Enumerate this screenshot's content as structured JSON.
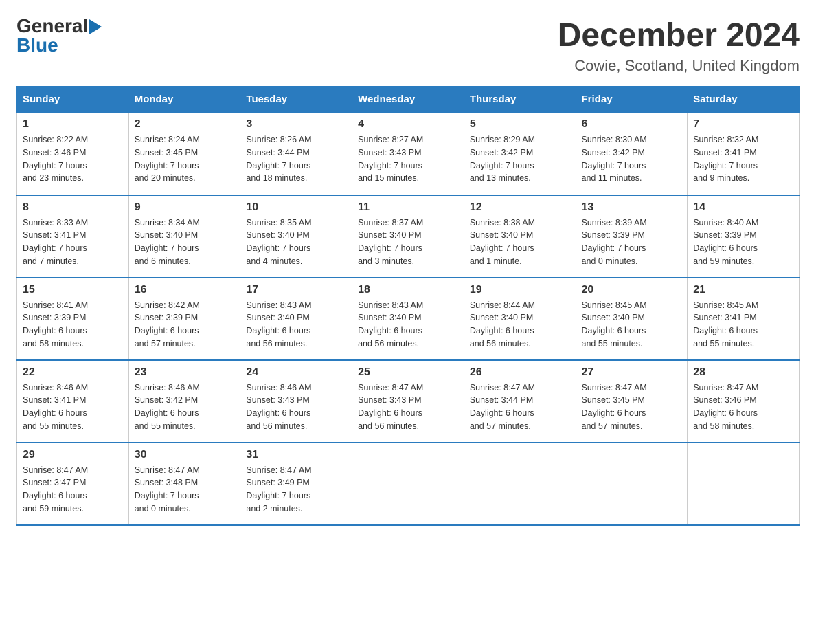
{
  "logo": {
    "general": "General",
    "flag_shape": "▶",
    "blue": "Blue"
  },
  "title": "December 2024",
  "location": "Cowie, Scotland, United Kingdom",
  "days_of_week": [
    "Sunday",
    "Monday",
    "Tuesday",
    "Wednesday",
    "Thursday",
    "Friday",
    "Saturday"
  ],
  "weeks": [
    [
      {
        "day": "1",
        "sunrise": "8:22 AM",
        "sunset": "3:46 PM",
        "daylight": "7 hours and 23 minutes."
      },
      {
        "day": "2",
        "sunrise": "8:24 AM",
        "sunset": "3:45 PM",
        "daylight": "7 hours and 20 minutes."
      },
      {
        "day": "3",
        "sunrise": "8:26 AM",
        "sunset": "3:44 PM",
        "daylight": "7 hours and 18 minutes."
      },
      {
        "day": "4",
        "sunrise": "8:27 AM",
        "sunset": "3:43 PM",
        "daylight": "7 hours and 15 minutes."
      },
      {
        "day": "5",
        "sunrise": "8:29 AM",
        "sunset": "3:42 PM",
        "daylight": "7 hours and 13 minutes."
      },
      {
        "day": "6",
        "sunrise": "8:30 AM",
        "sunset": "3:42 PM",
        "daylight": "7 hours and 11 minutes."
      },
      {
        "day": "7",
        "sunrise": "8:32 AM",
        "sunset": "3:41 PM",
        "daylight": "7 hours and 9 minutes."
      }
    ],
    [
      {
        "day": "8",
        "sunrise": "8:33 AM",
        "sunset": "3:41 PM",
        "daylight": "7 hours and 7 minutes."
      },
      {
        "day": "9",
        "sunrise": "8:34 AM",
        "sunset": "3:40 PM",
        "daylight": "7 hours and 6 minutes."
      },
      {
        "day": "10",
        "sunrise": "8:35 AM",
        "sunset": "3:40 PM",
        "daylight": "7 hours and 4 minutes."
      },
      {
        "day": "11",
        "sunrise": "8:37 AM",
        "sunset": "3:40 PM",
        "daylight": "7 hours and 3 minutes."
      },
      {
        "day": "12",
        "sunrise": "8:38 AM",
        "sunset": "3:40 PM",
        "daylight": "7 hours and 1 minute."
      },
      {
        "day": "13",
        "sunrise": "8:39 AM",
        "sunset": "3:39 PM",
        "daylight": "7 hours and 0 minutes."
      },
      {
        "day": "14",
        "sunrise": "8:40 AM",
        "sunset": "3:39 PM",
        "daylight": "6 hours and 59 minutes."
      }
    ],
    [
      {
        "day": "15",
        "sunrise": "8:41 AM",
        "sunset": "3:39 PM",
        "daylight": "6 hours and 58 minutes."
      },
      {
        "day": "16",
        "sunrise": "8:42 AM",
        "sunset": "3:39 PM",
        "daylight": "6 hours and 57 minutes."
      },
      {
        "day": "17",
        "sunrise": "8:43 AM",
        "sunset": "3:40 PM",
        "daylight": "6 hours and 56 minutes."
      },
      {
        "day": "18",
        "sunrise": "8:43 AM",
        "sunset": "3:40 PM",
        "daylight": "6 hours and 56 minutes."
      },
      {
        "day": "19",
        "sunrise": "8:44 AM",
        "sunset": "3:40 PM",
        "daylight": "6 hours and 56 minutes."
      },
      {
        "day": "20",
        "sunrise": "8:45 AM",
        "sunset": "3:40 PM",
        "daylight": "6 hours and 55 minutes."
      },
      {
        "day": "21",
        "sunrise": "8:45 AM",
        "sunset": "3:41 PM",
        "daylight": "6 hours and 55 minutes."
      }
    ],
    [
      {
        "day": "22",
        "sunrise": "8:46 AM",
        "sunset": "3:41 PM",
        "daylight": "6 hours and 55 minutes."
      },
      {
        "day": "23",
        "sunrise": "8:46 AM",
        "sunset": "3:42 PM",
        "daylight": "6 hours and 55 minutes."
      },
      {
        "day": "24",
        "sunrise": "8:46 AM",
        "sunset": "3:43 PM",
        "daylight": "6 hours and 56 minutes."
      },
      {
        "day": "25",
        "sunrise": "8:47 AM",
        "sunset": "3:43 PM",
        "daylight": "6 hours and 56 minutes."
      },
      {
        "day": "26",
        "sunrise": "8:47 AM",
        "sunset": "3:44 PM",
        "daylight": "6 hours and 57 minutes."
      },
      {
        "day": "27",
        "sunrise": "8:47 AM",
        "sunset": "3:45 PM",
        "daylight": "6 hours and 57 minutes."
      },
      {
        "day": "28",
        "sunrise": "8:47 AM",
        "sunset": "3:46 PM",
        "daylight": "6 hours and 58 minutes."
      }
    ],
    [
      {
        "day": "29",
        "sunrise": "8:47 AM",
        "sunset": "3:47 PM",
        "daylight": "6 hours and 59 minutes."
      },
      {
        "day": "30",
        "sunrise": "8:47 AM",
        "sunset": "3:48 PM",
        "daylight": "7 hours and 0 minutes."
      },
      {
        "day": "31",
        "sunrise": "8:47 AM",
        "sunset": "3:49 PM",
        "daylight": "7 hours and 2 minutes."
      },
      null,
      null,
      null,
      null
    ]
  ],
  "labels": {
    "sunrise": "Sunrise:",
    "sunset": "Sunset:",
    "daylight": "Daylight:"
  }
}
